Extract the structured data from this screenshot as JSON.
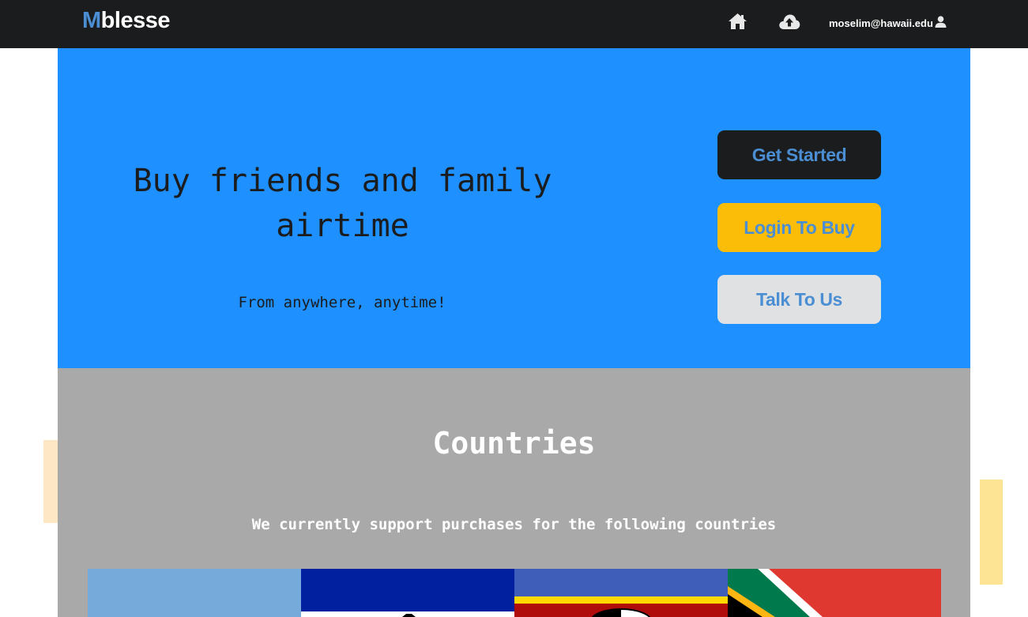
{
  "navbar": {
    "brand_initial": "M",
    "brand_rest": "blesse",
    "home_icon": "home-icon",
    "upload_icon": "cloud-upload-icon",
    "user_email": "moselim@hawaii.edu",
    "user_icon": "user-icon"
  },
  "hero": {
    "title": "Buy friends and family airtime",
    "subtitle": "From anywhere, anytime!",
    "buttons": {
      "get_started": "Get Started",
      "login_to_buy": "Login To Buy",
      "talk_to_us": "Talk To Us"
    }
  },
  "countries": {
    "title": "Countries",
    "subtitle": "We currently support purchases for the following countries",
    "flags": [
      "botswana-flag",
      "lesotho-flag",
      "eswatini-flag",
      "south-africa-flag"
    ]
  },
  "colors": {
    "navbar_bg": "#1b1c1d",
    "brand_accent": "#4b8ed3",
    "hero_bg": "#1e90ff",
    "countries_bg": "#a9a9a9",
    "button_dark": "#1b1c1d",
    "button_yellow": "#fbbd08",
    "button_light": "#e0e1e2"
  }
}
